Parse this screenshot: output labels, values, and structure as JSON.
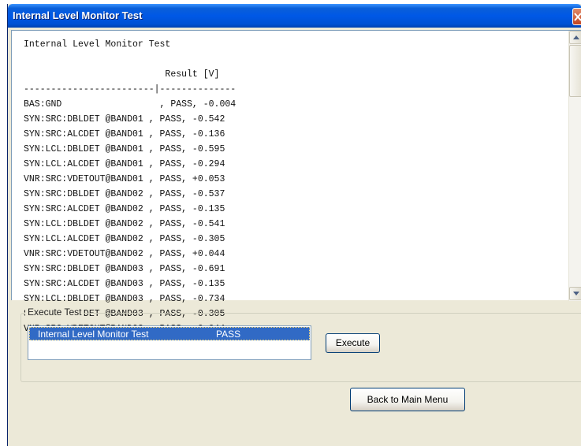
{
  "window": {
    "title": "Internal Level Monitor Test"
  },
  "log": {
    "lines": [
      "Internal Level Monitor Test",
      "",
      "                          Result [V]",
      "------------------------|--------------",
      "BAS:GND                  , PASS, -0.004",
      "SYN:SRC:DBLDET @BAND01 , PASS, -0.542",
      "SYN:SRC:ALCDET @BAND01 , PASS, -0.136",
      "SYN:LCL:DBLDET @BAND01 , PASS, -0.595",
      "SYN:LCL:ALCDET @BAND01 , PASS, -0.294",
      "VNR:SRC:VDETOUT@BAND01 , PASS, +0.053",
      "SYN:SRC:DBLDET @BAND02 , PASS, -0.537",
      "SYN:SRC:ALCDET @BAND02 , PASS, -0.135",
      "SYN:LCL:DBLDET @BAND02 , PASS, -0.541",
      "SYN:LCL:ALCDET @BAND02 , PASS, -0.305",
      "VNR:SRC:VDETOUT@BAND02 , PASS, +0.044",
      "SYN:SRC:DBLDET @BAND03 , PASS, -0.691",
      "SYN:SRC:ALCDET @BAND03 , PASS, -0.135",
      "SYN:LCL:DBLDET @BAND03 , PASS, -0.734",
      "SYN:LCL:ALCDET @BAND03 , PASS, -0.305",
      "VNR:SRC:VDETOUT@BAND03 , PASS, +0.044"
    ]
  },
  "execute_group": {
    "legend": "Execute Test",
    "list_items": [
      {
        "name": "Internal Level Monitor Test",
        "status": "PASS",
        "selected": true
      }
    ],
    "execute_label": "Execute"
  },
  "back_label": "Back to Main Menu",
  "colors": {
    "titlebar": "#0058e6",
    "selection": "#316ac5",
    "window_bg": "#ece9d8"
  },
  "icons": [
    "close-icon",
    "scroll-up-arrow-icon",
    "scroll-down-arrow-icon"
  ]
}
